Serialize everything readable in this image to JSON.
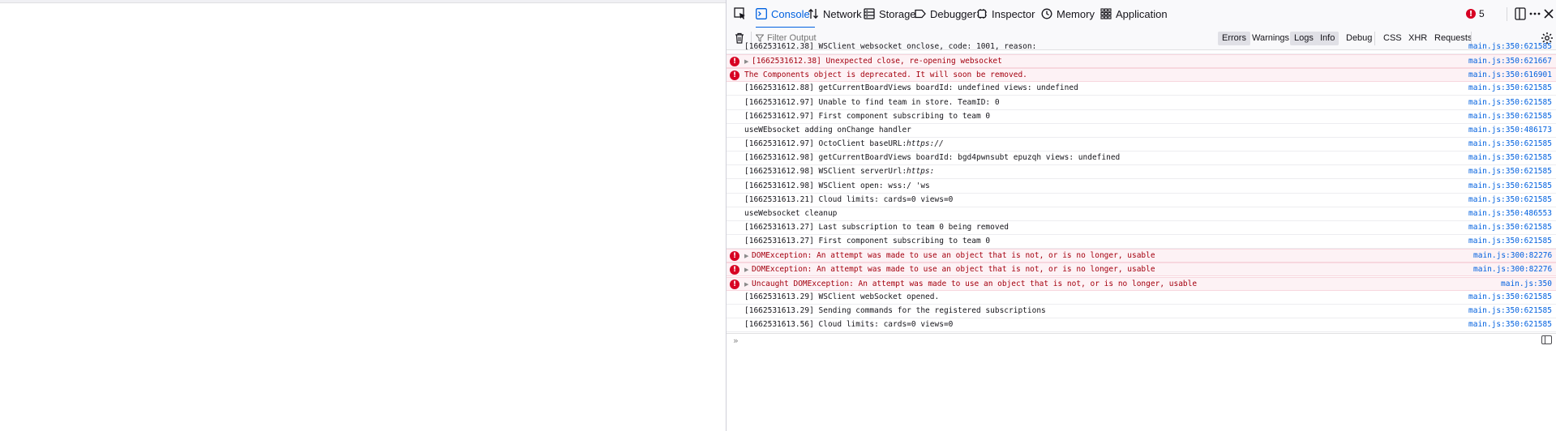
{
  "devtools": {
    "tabs": [
      {
        "label": "Console",
        "icon": "console-icon"
      },
      {
        "label": "Network",
        "icon": "network-icon"
      },
      {
        "label": "Storage",
        "icon": "storage-icon"
      },
      {
        "label": "Debugger",
        "icon": "debugger-icon"
      },
      {
        "label": "Inspector",
        "icon": "inspector-icon"
      },
      {
        "label": "Memory",
        "icon": "memory-icon"
      },
      {
        "label": "Application",
        "icon": "application-icon"
      }
    ],
    "error_count": "5",
    "active_tab": "Console"
  },
  "toolbar": {
    "filter_placeholder": "Filter Output",
    "filters": [
      "Errors",
      "Warnings",
      "Logs",
      "Info",
      "Debug"
    ],
    "filters_active": [
      "Errors",
      "Logs",
      "Info"
    ],
    "net_filters": [
      "CSS",
      "XHR",
      "Requests"
    ]
  },
  "console": {
    "rows": [
      {
        "type": "log",
        "expandable": false,
        "text": "[1662531612.38] WSClient websocket onclose, code: 1001, reason:",
        "source": "main.js:350:621585"
      },
      {
        "type": "error",
        "expandable": true,
        "text": "[1662531612.38] Unexpected close, re-opening websocket",
        "source": "main.js:350:621667"
      },
      {
        "type": "error",
        "expandable": false,
        "text": "The Components object is deprecated. It will soon be removed.",
        "source": "main.js:350:616901"
      },
      {
        "type": "log",
        "expandable": false,
        "text": "[1662531612.88] getCurrentBoardViews boardId: undefined views: undefined",
        "source": "main.js:350:621585"
      },
      {
        "type": "log",
        "expandable": false,
        "text": "[1662531612.97] Unable to find team in store. TeamID: 0",
        "source": "main.js:350:621585"
      },
      {
        "type": "log",
        "expandable": false,
        "text": "[1662531612.97] First component subscribing to team 0",
        "source": "main.js:350:621585"
      },
      {
        "type": "log",
        "expandable": false,
        "text": "useWEbsocket adding onChange handler",
        "source": "main.js:350:486173"
      },
      {
        "type": "log",
        "expandable": false,
        "text": "[1662531612.97] OctoClient baseURL: ",
        "italic": "https://",
        "source": "main.js:350:621585"
      },
      {
        "type": "log",
        "expandable": false,
        "text": "[1662531612.98] getCurrentBoardViews boardId: bgd4pwnsubt         epuzqh views: undefined",
        "source": "main.js:350:621585"
      },
      {
        "type": "log",
        "expandable": false,
        "text": "[1662531612.98] WSClient serverUrl: ",
        "italic": "https:",
        "source": "main.js:350:621585"
      },
      {
        "type": "log",
        "expandable": false,
        "text": "[1662531612.98] WSClient open: wss:/                     'ws",
        "source": "main.js:350:621585"
      },
      {
        "type": "log",
        "expandable": false,
        "text": "[1662531613.21] Cloud limits: cards=0   views=0",
        "source": "main.js:350:621585"
      },
      {
        "type": "log",
        "expandable": false,
        "text": "useWebsocket cleanup",
        "source": "main.js:350:486553"
      },
      {
        "type": "log",
        "expandable": false,
        "text": "[1662531613.27] Last subscription to team 0 being removed",
        "source": "main.js:350:621585"
      },
      {
        "type": "log",
        "expandable": false,
        "text": "[1662531613.27] First component subscribing to team 0",
        "source": "main.js:350:621585"
      },
      {
        "type": "error",
        "expandable": true,
        "text": "DOMException: An attempt was made to use an object that is not, or is no longer, usable",
        "source": "main.js:300:82276"
      },
      {
        "type": "error",
        "expandable": true,
        "text": "DOMException: An attempt was made to use an object that is not, or is no longer, usable",
        "source": "main.js:300:82276"
      },
      {
        "type": "error",
        "expandable": true,
        "text": "Uncaught DOMException: An attempt was made to use an object that is not, or is no longer, usable",
        "source": "main.js:350"
      },
      {
        "type": "log",
        "expandable": false,
        "text": "[1662531613.29] WSClient webSocket opened.",
        "source": "main.js:350:621585"
      },
      {
        "type": "log",
        "expandable": false,
        "text": "[1662531613.29] Sending commands for the registered subscriptions",
        "source": "main.js:350:621585"
      },
      {
        "type": "log",
        "expandable": false,
        "text": "[1662531613.56] Cloud limits: cards=0   views=0",
        "source": "main.js:350:621585"
      }
    ]
  },
  "colors": {
    "accent": "#0061e0",
    "error_text": "#a4000f",
    "error_bg": "#fdf2f5",
    "error_icon": "#d70022",
    "link": "#0060df"
  }
}
